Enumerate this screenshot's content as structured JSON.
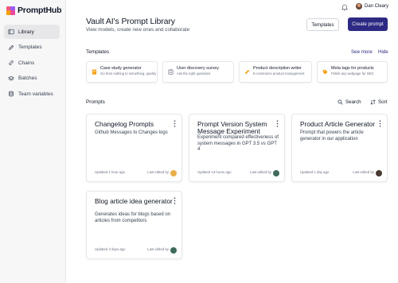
{
  "app": {
    "name": "PromptHub",
    "logo_colors": [
      "#f0567a",
      "#9b5cf6",
      "#f59e0b",
      "#22c55e"
    ]
  },
  "sidebar": {
    "items": [
      {
        "label": "Library",
        "icon": "book-icon",
        "active": true
      },
      {
        "label": "Templates",
        "icon": "pencil-icon",
        "active": false
      },
      {
        "label": "Chains",
        "icon": "link-icon",
        "active": false
      },
      {
        "label": "Batches",
        "icon": "layers-icon",
        "active": false
      },
      {
        "label": "Team variables",
        "icon": "database-icon",
        "active": false
      }
    ]
  },
  "topbar": {
    "user_name": "Dan Cleary",
    "bell_icon": "bell-icon"
  },
  "header": {
    "title": "Vault AI's Prompt Library",
    "subtitle": "View models, create new ones and collaborate",
    "templates_button": "Templates",
    "create_button": "Create prompt"
  },
  "templates_section": {
    "label": "Templates",
    "see_more": "See more",
    "hide": "Hide",
    "items": [
      {
        "title": "Case study generator",
        "desc": "Go from nothing to something, quickly",
        "icon": "document-icon",
        "icon_color": "#f59e0b"
      },
      {
        "title": "User discovery survey",
        "desc": "Ask the right questions",
        "icon": "clipboard-icon",
        "icon_color": "#6b7280"
      },
      {
        "title": "Product description writer",
        "desc": "E-commerce product management",
        "icon": "pencil-icon",
        "icon_color": "#f59e0b"
      },
      {
        "title": "Meta tags for products",
        "desc": "Polish any webpage for SEO",
        "icon": "tag-icon",
        "icon_color": "#f59e0b"
      }
    ]
  },
  "prompts_section": {
    "label": "Prompts",
    "search": "Search",
    "sort": "Sort",
    "edited_label": "Last edited by",
    "cards": [
      {
        "title": "Changelog Prompts",
        "desc": "Github Messages to Changes logs",
        "updated": "Updated 1 hour ago",
        "avatar_color": "#e8b04a"
      },
      {
        "title": "Prompt Version System Message Experiment",
        "desc": "Experiment compared effectiveness of system messages in GPT 3.5 vs GPT 4",
        "updated": "Updated 13 hours ago",
        "avatar_color": "#3f6b5a"
      },
      {
        "title": "Product Article Generator",
        "desc": "Prompt that powers the article generator in our application",
        "updated": "Updated 1 day ago",
        "avatar_color": "#4a3a34"
      },
      {
        "title": "Blog article idea generator",
        "desc": "Generates ideas for blogs based on articles from competitors",
        "updated": "Updated 3 days ago",
        "avatar_color": "#3f6b5a"
      }
    ]
  },
  "colors": {
    "accent": "#2d2a83",
    "sidebar_bg": "#f7f7f8",
    "border": "#e5e7eb"
  }
}
